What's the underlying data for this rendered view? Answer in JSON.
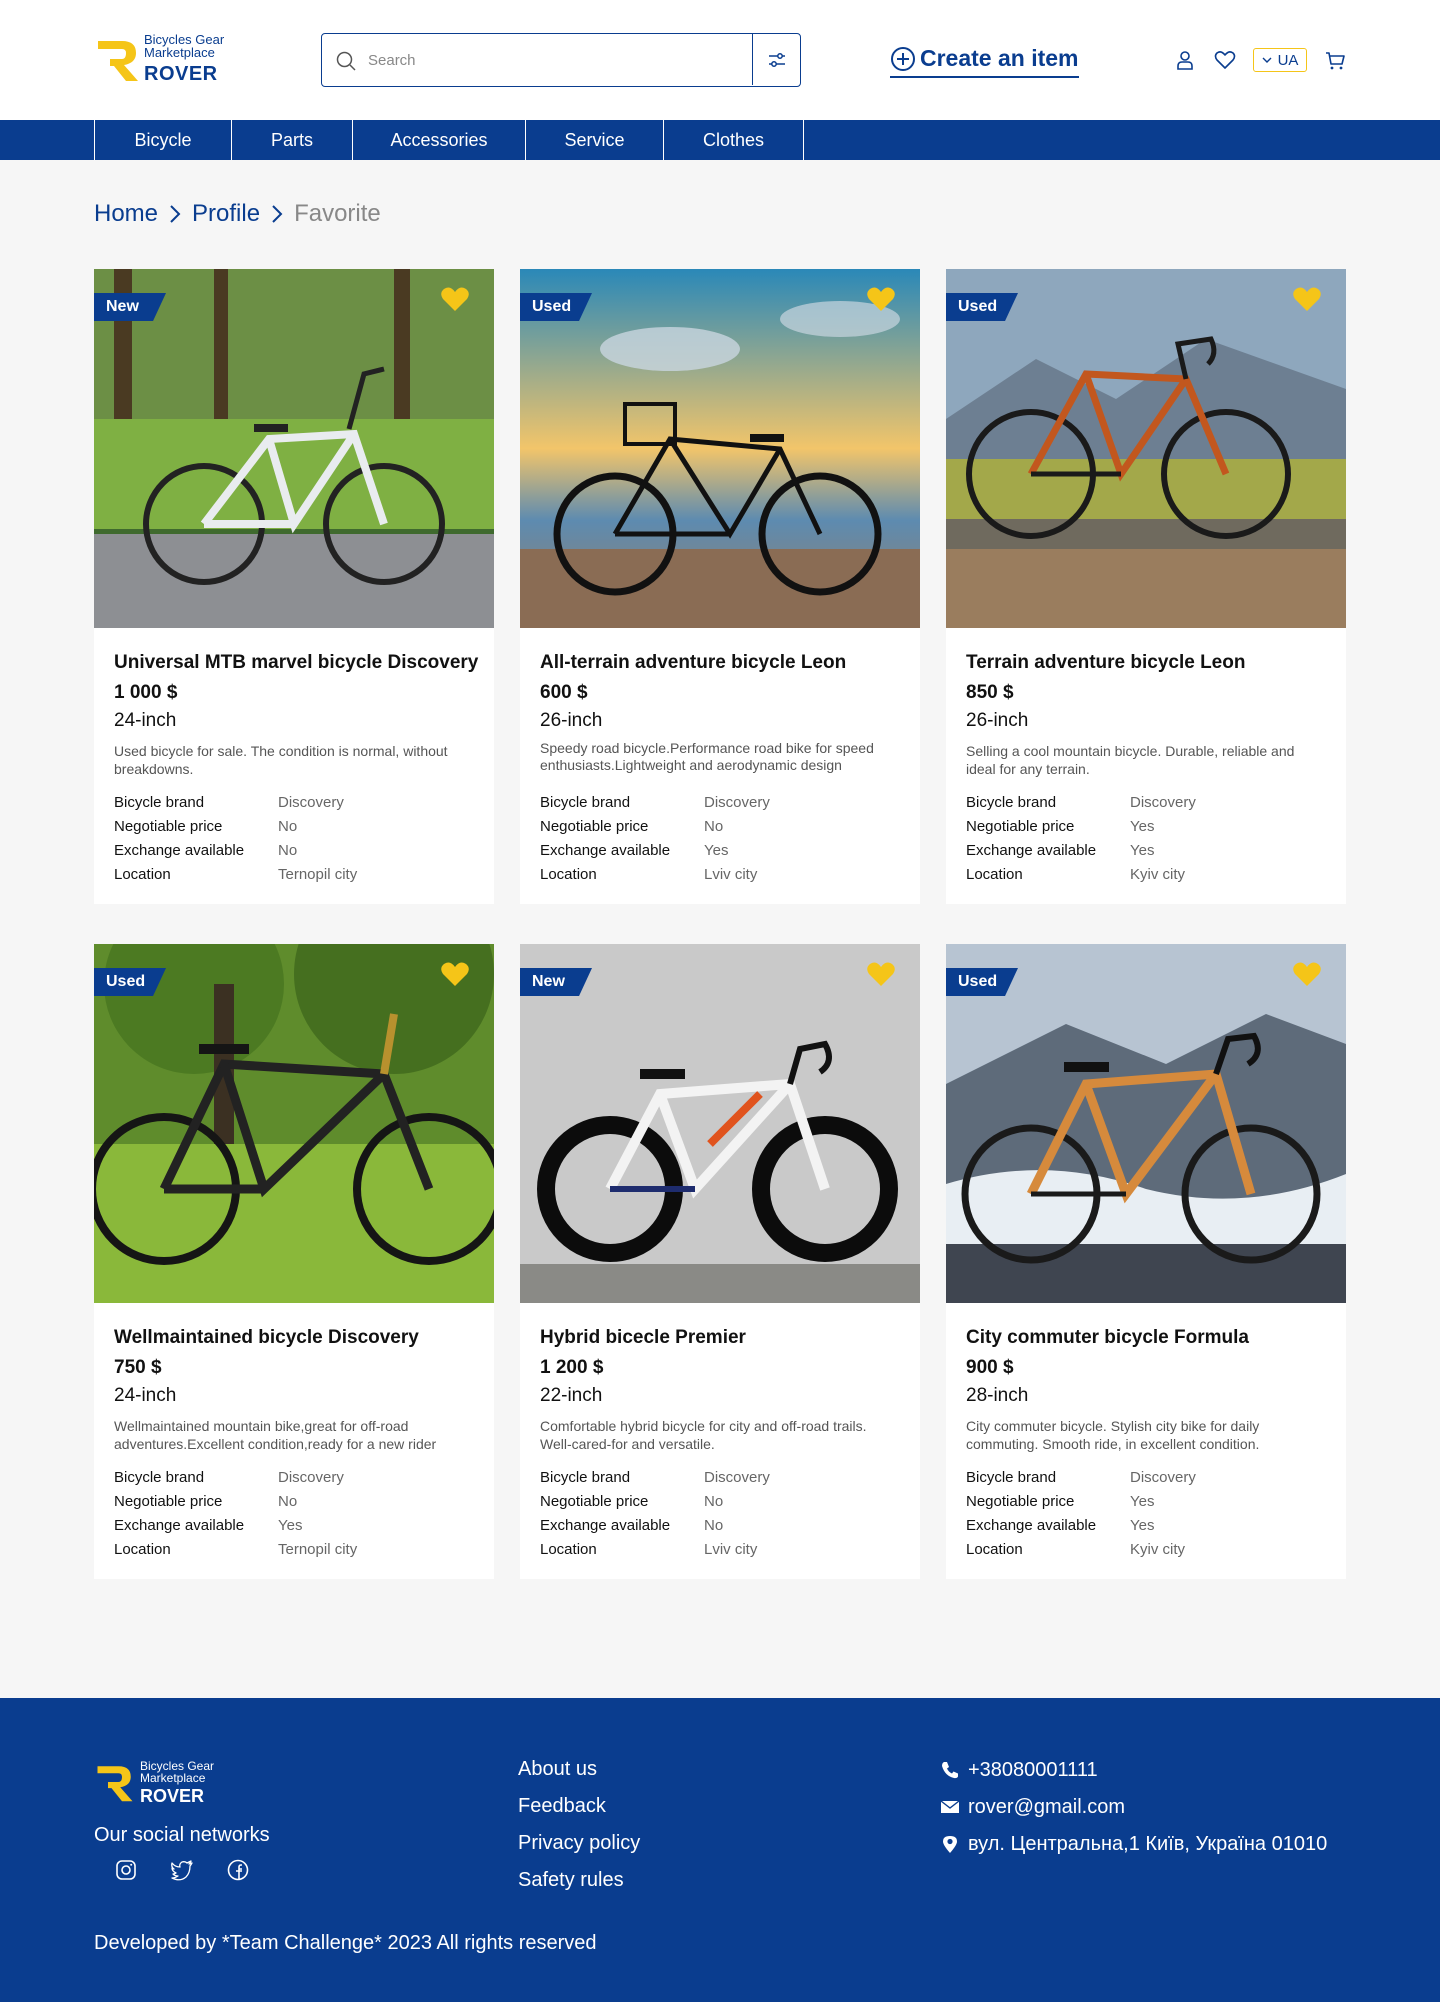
{
  "brand": {
    "subtitle_line1": "Bicycles Gear",
    "subtitle_line2": "Marketplace",
    "name": "ROVER"
  },
  "search": {
    "placeholder": "Search"
  },
  "header": {
    "create_label": "Create an item",
    "language": "UA"
  },
  "nav": {
    "items": [
      "Bicycle",
      "Parts",
      "Accessories",
      "Service",
      "Clothes"
    ]
  },
  "breadcrumb": {
    "home": "Home",
    "profile": "Profile",
    "current": "Favorite"
  },
  "colors": {
    "primary": "#0a3d8f",
    "accent": "#f5c518"
  },
  "spec_labels": {
    "brand": "Bicycle brand",
    "negotiable": "Negotiable price",
    "exchange": "Exchange available",
    "location": "Location"
  },
  "cards": [
    {
      "badge": "New",
      "title": "Universal MTB marvel bicycle Discovery",
      "price": "1 000 $",
      "size": "24-inch",
      "description": "Used bicycle for sale. The condition is normal, without breakdowns.",
      "brand": "Discovery",
      "negotiable": "No",
      "exchange": "No",
      "location": "Ternopil city"
    },
    {
      "badge": "Used",
      "title": "All-terrain adventure bicycle Leon",
      "price": "600 $",
      "size": "26-inch",
      "description": "Speedy road bicycle.Performance road bike for speed enthusiasts.Lightweight and aerodynamic design",
      "brand": "Discovery",
      "negotiable": "No",
      "exchange": "Yes",
      "location": "Lviv city"
    },
    {
      "badge": "Used",
      "title": "Terrain adventure bicycle Leon",
      "price": "850 $",
      "size": "26-inch",
      "description": "Selling a cool mountain bicycle. Durable, reliable and ideal for any terrain.",
      "brand": "Discovery",
      "negotiable": "Yes",
      "exchange": "Yes",
      "location": "Kyiv city"
    },
    {
      "badge": "Used",
      "title": "Wellmaintained bicycle Discovery",
      "price": "750 $",
      "size": "24-inch",
      "description": "Wellmaintained mountain bike,great for off-road adventures.Excellent condition,ready for a new rider",
      "brand": "Discovery",
      "negotiable": "No",
      "exchange": "Yes",
      "location": "Ternopil city"
    },
    {
      "badge": "New",
      "title": "Hybrid bicecle Premier",
      "price": "1 200 $",
      "size": "22-inch",
      "description": "Comfortable hybrid bicycle for city and off-road trails. Well-cared-for and versatile.",
      "brand": "Discovery",
      "negotiable": "No",
      "exchange": "No",
      "location": "Lviv city"
    },
    {
      "badge": "Used",
      "title": "City commuter bicycle Formula",
      "price": "900 $",
      "size": "28-inch",
      "description": "City commuter bicycle. Stylish city bike for daily commuting. Smooth ride, in excellent condition.",
      "brand": "Discovery",
      "negotiable": "Yes",
      "exchange": "Yes",
      "location": "Kyiv city"
    }
  ],
  "footer": {
    "social_title": "Our social networks",
    "links": [
      "About us",
      "Feedback",
      "Privacy policy",
      "Safety rules"
    ],
    "phone": "+38080001111",
    "email": "rover@gmail.com",
    "address": "вул. Центральна,1 Київ, Україна 01010",
    "copyright": "Developed by *Team Challenge* 2023 All rights reserved"
  }
}
